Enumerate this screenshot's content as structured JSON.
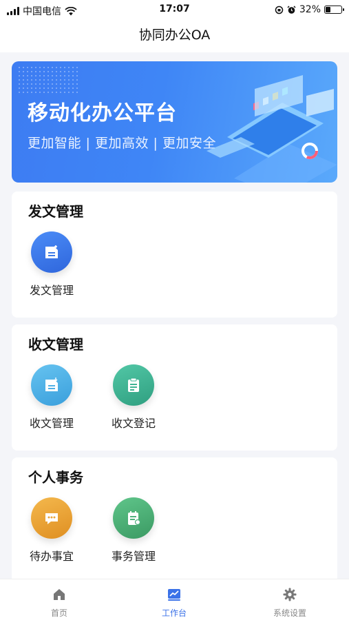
{
  "status_bar": {
    "carrier": "中国电信",
    "time": "17:07",
    "battery": "32%",
    "battery_level": 0.32
  },
  "nav": {
    "title": "协同办公OA"
  },
  "banner": {
    "title": "移动化办公平台",
    "subtitle": "更加智能 | 更加高效 | 更加安全"
  },
  "sections": [
    {
      "title": "发文管理",
      "items": [
        {
          "label": "发文管理",
          "icon": "document-icon",
          "color": "#3d7ae8"
        }
      ]
    },
    {
      "title": "收文管理",
      "items": [
        {
          "label": "收文管理",
          "icon": "inbox-document-icon",
          "color": "#4fb0e6"
        },
        {
          "label": "收文登记",
          "icon": "clipboard-icon",
          "color": "#3fb394"
        }
      ]
    },
    {
      "title": "个人事务",
      "items": [
        {
          "label": "待办事宜",
          "icon": "chat-icon",
          "color": "#eba53b"
        },
        {
          "label": "事务管理",
          "icon": "notebook-icon",
          "color": "#4fb07c"
        }
      ]
    }
  ],
  "tab_bar": {
    "tabs": [
      {
        "label": "首页",
        "icon": "home-icon",
        "active": false
      },
      {
        "label": "工作台",
        "icon": "chart-icon",
        "active": true
      },
      {
        "label": "系统设置",
        "icon": "gear-icon",
        "active": false
      }
    ]
  },
  "colors": {
    "accent": "#3b72e8",
    "background": "#f4f5f9"
  }
}
